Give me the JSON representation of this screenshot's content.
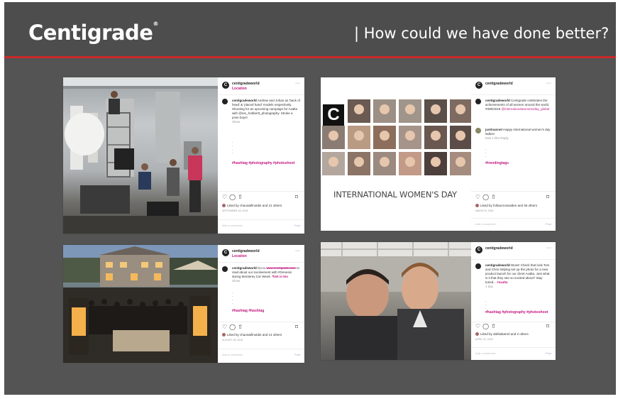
{
  "header": {
    "logo": "Centigrade",
    "title": "| How could we have done better?"
  },
  "colors": {
    "background": "#545454",
    "header": "#4d4d4d",
    "accent_line": "#c92a28",
    "hashtag": "#c2187f"
  },
  "posts": [
    {
      "username": "centigradeworld",
      "location": "Location",
      "caption_user": "centigradeworld",
      "caption": "Andrew and Johan as 'back of head' & 'placed hand' models respectively. Shooting for an upcoming campaign for Axalta with @rex_hobbertt_photography. Stroke a pose boys!",
      "caption_more": "Show",
      "dots": "·\n·\n·\n·",
      "hashtags": "#hashtag #photography #photoshoot",
      "likes": "Liked by chaoswillnotdie and 21 others",
      "date": "SEPTEMBER 18, 2018",
      "comment_placeholder": "Add a comment...",
      "post_btn": "Post"
    },
    {
      "username": "centigradeworld",
      "caption_user": "centigradeworld",
      "caption": "Centigrade celebrates the achievements of all women around the world. #IWD2018",
      "caption_link": "@internationalwomensday_global",
      "reply_user": "justinannet",
      "reply": "Happy international women's day ladies!",
      "reply_meta": "52w   1 like   Reply",
      "dots": "·\n·\n·",
      "hashtags": "#trendingtags",
      "graphic_text": "INTERNATIONAL WOMEN'S DAY",
      "graphic_logo": "C",
      "likes": "Liked by followcrossaiden and 36 others",
      "date": "MARCH 8, 2018",
      "comment_placeholder": "Add a comment...",
      "post_btn": "Post"
    },
    {
      "username": "centigradeworld",
      "location": "Location",
      "caption_user": "centigradeworld",
      "caption_pre": "Go to",
      "caption_link": "www.centigrade.com",
      "caption_post": "to read about our involvement with #Genesis during Monterey Car Week.",
      "caption_tag": "*link in bio",
      "caption_more": "Show",
      "dots": "·\n·\n·\n·",
      "hashtags": "#hashtag #hashtag",
      "likes": "Liked by chaoswillnotdie and 14 others",
      "date": "AUGUST 28, 2018",
      "comment_placeholder": "Add a comment...",
      "post_btn": "Post"
    },
    {
      "username": "centigradeworld",
      "caption_user": "centigradeworld",
      "caption": "Wow!! Check that look Tom and Chris helping set up the photo for a new product launch for our client Axalta. Just what is it that they see so excited about? Stay tuned...",
      "caption_tag": "#axalta",
      "caption_more": "1 day",
      "dots": "·\n·\n·",
      "hashtags": "#hashtag #photography #photoshoot",
      "likes": "Liked by dahliabarrel and 2 others",
      "date": "APRIL 22, 2018",
      "comment_placeholder": "Add a comment...",
      "post_btn": "Post"
    }
  ]
}
